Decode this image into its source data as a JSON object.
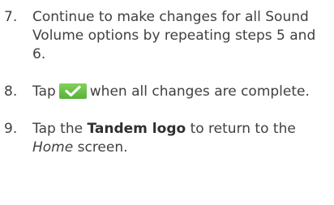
{
  "steps": [
    {
      "number": "7.",
      "text": "Continue to make changes for all Sound Volume options by repeating steps 5 and 6."
    },
    {
      "number": "8.",
      "before": "Tap",
      "icon": "checkmark-icon",
      "after": "when all changes are complete."
    },
    {
      "number": "9.",
      "before": "Tap the",
      "bold": "Tandem logo",
      "middle": "to return to the",
      "italic": "Home",
      "after": "screen."
    }
  ],
  "colors": {
    "text": "#404040",
    "check_button": "#6cc24a",
    "check_mark": "#ffffff"
  }
}
